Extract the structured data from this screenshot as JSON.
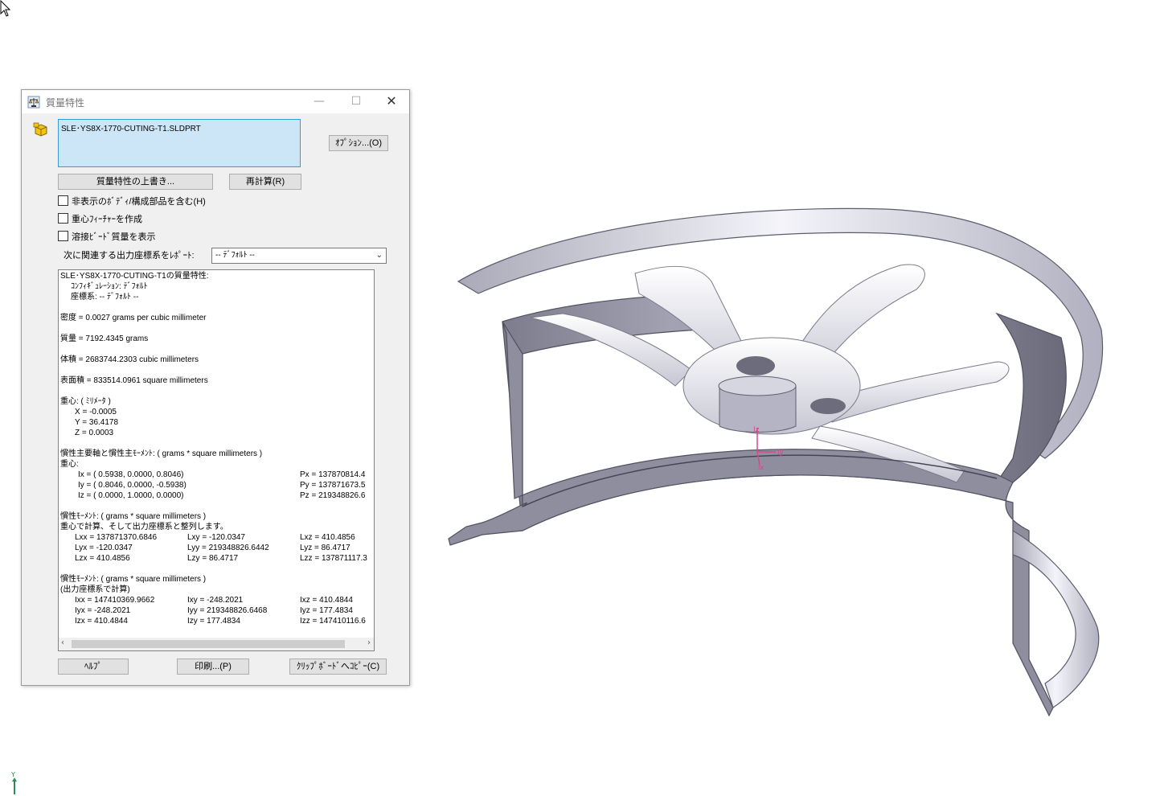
{
  "dialog": {
    "title": "質量特性",
    "selection": "SLE･YS8X-1770-CUTING-T1.SLDPRT",
    "buttons": {
      "options": "ｵﾌﾟｼｮﾝ...(O)",
      "override": "質量特性の上書き...",
      "recalculate": "再計算(R)",
      "help": "ﾍﾙﾌﾟ",
      "print": "印刷...(P)",
      "copy": "ｸﾘｯﾌﾟﾎﾞｰﾄﾞへｺﾋﾟｰ(C)"
    },
    "checkboxes": {
      "hidden_bodies": "非表示のﾎﾞﾃﾞｨ/構成部品を含む(H)",
      "cog_feature": "重心ﾌｨｰﾁｬｰを作成",
      "weld_bead": "溶接ﾋﾞｰﾄﾞ質量を表示"
    },
    "coord_label": "次に関連する出力座標系をﾚﾎﾟｰﾄ:",
    "coord_value": "-- ﾃﾞﾌｫﾙﾄ --",
    "results": {
      "header": "SLE･YS8X-1770-CUTING-T1の質量特性:",
      "config": "ｺﾝﾌｨｷﾞｭﾚｰｼｮﾝ: ﾃﾞﾌｫﾙﾄ",
      "coordsys": "座標系: -- ﾃﾞﾌｫﾙﾄ --",
      "density": "密度 = 0.0027 grams per cubic millimeter",
      "mass": "質量 = 7192.4345 grams",
      "volume": "体積 = 2683744.2303 cubic millimeters",
      "area": "表面積 = 833514.0961  square millimeters",
      "com_title": "重心: ( ﾐﾘﾒｰﾀ )",
      "com_x": "X = -0.0005",
      "com_y": "Y = 36.4178",
      "com_z": "Z = 0.0003",
      "principal_title": "慣性主要軸と慣性主ﾓｰﾒﾝﾄ: ( grams *  square millimeters )",
      "principal_sub": "重心:",
      "ix": "Ix = ( 0.5938,  0.0000,  0.8046)",
      "iy": "Iy = ( 0.8046,  0.0000, -0.5938)",
      "iz": "Iz = ( 0.0000,  1.0000,  0.0000)",
      "px": "Px = 137870814.4",
      "py": "Py = 137871673.5",
      "pz": "Pz = 219348826.6",
      "moi1_title": "慣性ﾓｰﾒﾝﾄ: ( grams *  square millimeters )",
      "moi1_sub": "重心で計算、そして出力座標系と整列します。",
      "lxx": "Lxx = 137871370.6846",
      "lxy": "Lxy = -120.0347",
      "lxz": "Lxz = 410.4856",
      "lyx": "Lyx = -120.0347",
      "lyy": "Lyy = 219348826.6442",
      "lyz": "Lyz = 86.4717",
      "lzx": "Lzx = 410.4856",
      "lzy": "Lzy = 86.4717",
      "lzz": "Lzz = 137871117.3",
      "moi2_title": "慣性ﾓｰﾒﾝﾄ: ( grams *  square millimeters )",
      "moi2_sub": "(出力座標系で計算)",
      "ixx": "Ixx = 147410369.9662",
      "ixy": "Ixy = -248.2021",
      "ixz": "Ixz = 410.4844",
      "iyx": "Iyx = -248.2021",
      "iyy": "Iyy = 219348826.6468",
      "iyz": "Iyz = 177.4834",
      "izx": "Izx = 410.4844",
      "izy": "Izy = 177.4834",
      "izz": "Izz = 147410116.6"
    }
  },
  "viewport": {
    "axis_z": "Iz",
    "axis_y": "Iy",
    "axis_x": "Ix",
    "triad_y": "Y",
    "accent_color": "#d9468c",
    "triad_color": "#2e8b57"
  }
}
